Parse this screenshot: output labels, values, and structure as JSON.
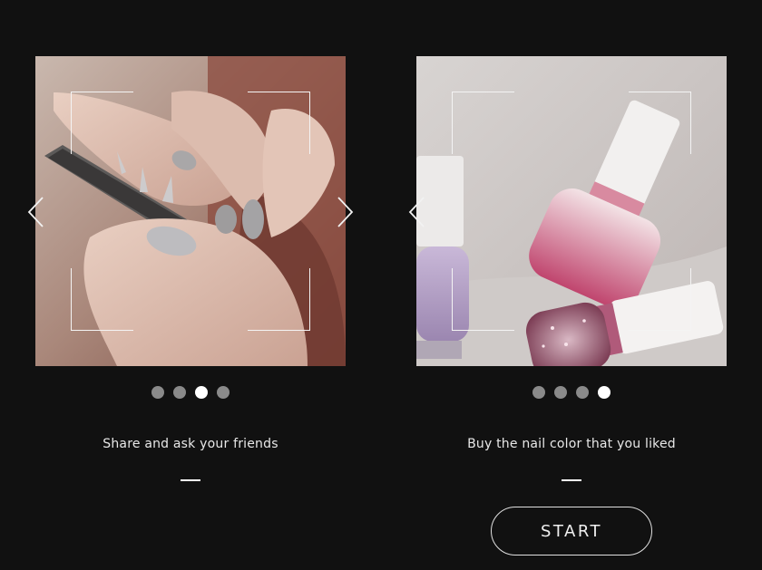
{
  "slides": [
    {
      "caption": "Share and ask your friends",
      "image": "hand-with-grey-nails-holding-phone",
      "dots": {
        "count": 4,
        "active_index": 2
      }
    },
    {
      "caption": "Buy the nail color that you liked",
      "image": "nail-polish-bottles",
      "dots": {
        "count": 4,
        "active_index": 3
      }
    }
  ],
  "start_button": {
    "label": "START"
  },
  "icons": {
    "prev": "chevron-left-icon",
    "next": "chevron-right-icon"
  },
  "colors": {
    "background": "#111111",
    "dot_inactive": "#8a8a8a",
    "dot_active": "#ffffff",
    "text": "#e8e8e8"
  }
}
